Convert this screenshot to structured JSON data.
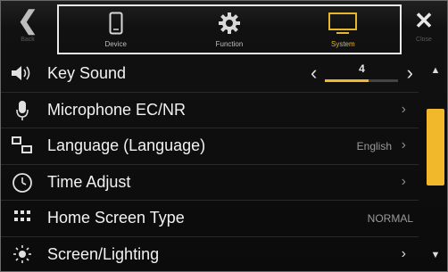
{
  "topbar": {
    "back_label": "Back",
    "close_label": "Close",
    "tabs": [
      {
        "label": "Device",
        "icon": "phone-icon",
        "active": false
      },
      {
        "label": "Function",
        "icon": "gear-icon",
        "active": false
      },
      {
        "label": "System",
        "icon": "monitor-icon",
        "active": true
      }
    ]
  },
  "list": {
    "items": [
      {
        "label": "Key Sound",
        "icon": "speaker-icon",
        "value": "4",
        "control": "stepper",
        "level_fraction": 0.6
      },
      {
        "label": "Microphone EC/NR",
        "icon": "microphone-icon",
        "value": "",
        "control": "chevron"
      },
      {
        "label": "Language (Language)",
        "icon": "language-icon",
        "value": "English",
        "control": "chevron"
      },
      {
        "label": "Time Adjust",
        "icon": "clock-icon",
        "value": "",
        "control": "chevron"
      },
      {
        "label": "Home Screen Type",
        "icon": "grid-icon",
        "value": "NORMAL",
        "control": "value"
      },
      {
        "label": "Screen/Lighting",
        "icon": "brightness-icon",
        "value": "",
        "control": "chevron"
      }
    ]
  },
  "scrollbar": {
    "position_fraction": 0.15,
    "visible_fraction": 0.45
  },
  "colors": {
    "accent": "#f0b82a",
    "background": "#0b0b0b",
    "text": "#f2f2f2"
  }
}
